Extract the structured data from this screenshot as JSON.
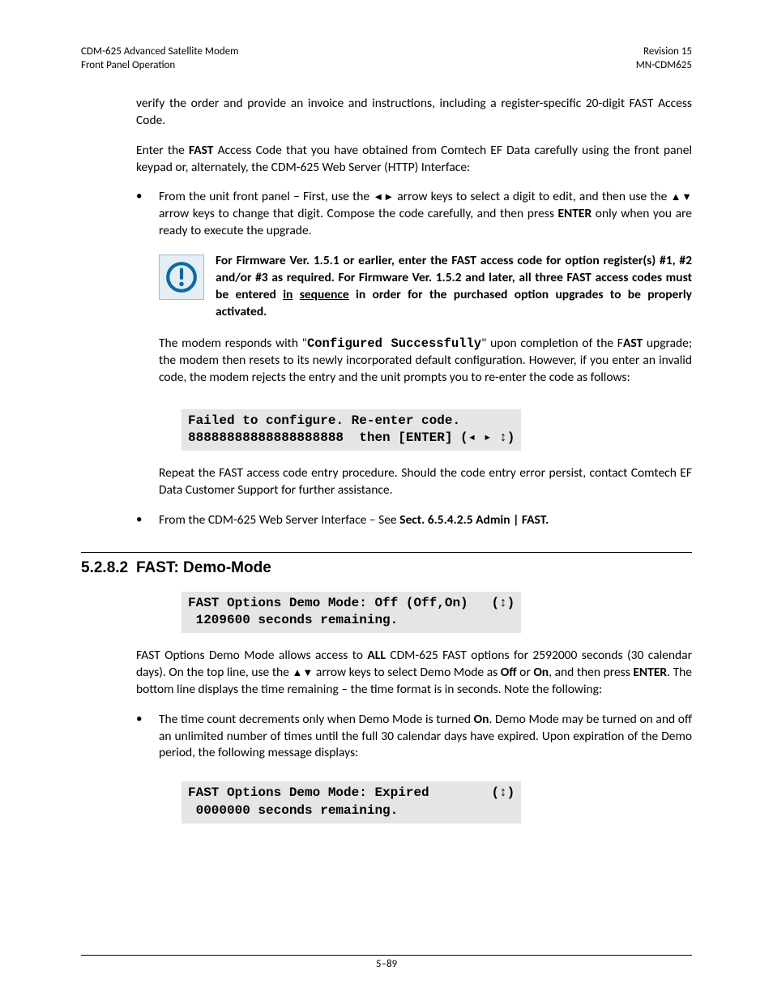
{
  "header": {
    "left1": "CDM-625 Advanced Satellite Modem",
    "left2": "Front Panel Operation",
    "right1": "Revision 15",
    "right2": "MN-CDM625"
  },
  "body": {
    "p1": "verify the order and provide an invoice and instructions, including a register-specific 20-digit FAST Access Code.",
    "p2a": "Enter the ",
    "p2b": "FAST",
    "p2c": " Access Code that you have obtained from Comtech EF Data carefully using the front panel keypad or, alternately, the CDM-625 Web Server (HTTP) Interface:",
    "b1a": "From the unit front panel – First, use the ",
    "b1arrows1": "◄►",
    "b1b": " arrow keys to select a digit to edit, and then use the ",
    "b1arrows2": "▲▼",
    "b1c": " arrow keys to change that digit. Compose the code carefully, and then press ",
    "b1enter": "ENTER",
    "b1d": " only when you are ready to execute the upgrade.",
    "note_a": "For Firmware Ver. 1.5.1 or earlier, enter the FAST access code for option register(s) #1, #2 and/or #3 as required. For Firmware Ver. 1.5.2 and later, all three FAST access codes must be entered ",
    "note_in": "in",
    "note_sp": " ",
    "note_seq": "sequence",
    "note_b": " in order for the purchased option upgrades to be properly activated.",
    "p3a": "The modem responds with \"",
    "p3code": "Configured Successfully",
    "p3b": "\" upon completion of the F",
    "p3ast": "AST",
    "p3c": " upgrade; the modem then resets to its newly incorporated default configuration. However, if you enter an invalid code, the modem rejects the entry and the unit prompts you to re-enter the code as follows:",
    "code1": "Failed to configure. Re-enter code.\n88888888888888888888  then [ENTER] (◂ ▸ ↕)",
    "p4": "Repeat the FAST access code entry procedure. Should the code entry error persist, contact Comtech EF Data Customer Support for further assistance.",
    "b2a": "From the CDM-625 Web Server Interface – See ",
    "b2b": "Sect. 6.5.4.2.5 Admin | FAST."
  },
  "section": {
    "num": "5.2.8.2",
    "title": "FAST: Demo-Mode",
    "code2": "FAST Options Demo Mode: Off (Off,On)   (↕)\n 1209600 seconds remaining.           ",
    "p5a": "FAST Options Demo Mode allows access to ",
    "p5all": "ALL",
    "p5b": " CDM-625 FAST options for 2592000 seconds (30 calendar days). On the top line, use the ",
    "p5arrows": "▲▼",
    "p5c": " arrow keys to select Demo Mode as ",
    "p5off": "Off",
    "p5or": " or ",
    "p5on": "On",
    "p5d": ", and then press ",
    "p5enter": "ENTER",
    "p5e": ". The bottom line displays the time remaining – the time format is in seconds. Note the following:",
    "b3a": "The time count decrements only when Demo Mode is turned ",
    "b3on": "On",
    "b3b": ". Demo Mode may be turned on and off an unlimited number of times until the full 30 calendar days have expired. Upon expiration of the Demo period, the following message displays:",
    "code3": "FAST Options Demo Mode: Expired        (↕)\n 0000000 seconds remaining.            "
  },
  "footer": {
    "page": "5–89"
  }
}
